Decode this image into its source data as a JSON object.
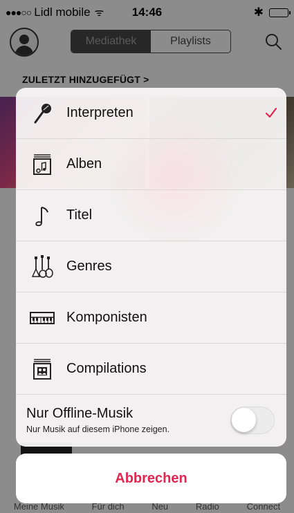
{
  "status_bar": {
    "signal": "●●●○○",
    "carrier": "Lidl mobile",
    "wifi": "ᯤ",
    "time": "14:46",
    "bluetooth": "✱"
  },
  "navbar": {
    "segments": [
      "Mediathek",
      "Playlists"
    ],
    "selected_segment": "Mediathek"
  },
  "library": {
    "section_title": "ZULETZT HINZUGEFÜGT >"
  },
  "tabbar": {
    "items": [
      "Meine Musik",
      "Für dich",
      "Neu",
      "Radio",
      "Connect"
    ]
  },
  "action_sheet": {
    "items": [
      {
        "label": "Interpreten",
        "icon": "microphone-icon",
        "checked": true
      },
      {
        "label": "Alben",
        "icon": "album-icon",
        "checked": false
      },
      {
        "label": "Titel",
        "icon": "music-note-icon",
        "checked": false
      },
      {
        "label": "Genres",
        "icon": "guitars-icon",
        "checked": false
      },
      {
        "label": "Komponisten",
        "icon": "piano-keys-icon",
        "checked": false
      },
      {
        "label": "Compilations",
        "icon": "compilation-icon",
        "checked": false
      }
    ],
    "offline": {
      "title": "Nur Offline-Musik",
      "subtitle": "Nur Musik auf diesem iPhone zeigen.",
      "enabled": false
    },
    "cancel_label": "Abbrechen"
  },
  "colors": {
    "accent": "#e2264f",
    "dim_overlay": "#000000"
  }
}
